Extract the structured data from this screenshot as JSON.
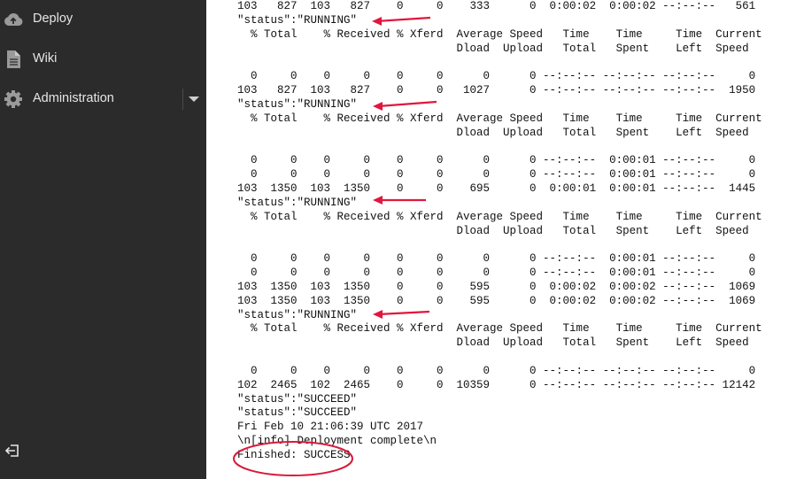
{
  "sidebar": {
    "items": [
      {
        "label": "Deploy",
        "icon": "cloud-upload-icon"
      },
      {
        "label": "Wiki",
        "icon": "document-icon"
      },
      {
        "label": "Administration",
        "icon": "gear-icon"
      }
    ],
    "dropdown_icon": "caret-down-icon",
    "footer_icon": "logout-icon"
  },
  "console": {
    "lines": [
      "103   827  103   827    0     0    333      0  0:00:02  0:00:02 --:--:--   561",
      "\"status\":\"RUNNING\"",
      "  % Total    % Received % Xferd  Average Speed   Time    Time     Time  Current",
      "                                 Dload  Upload   Total   Spent    Left  Speed",
      "",
      "  0     0    0     0    0     0      0      0 --:--:-- --:--:-- --:--:--     0",
      "103   827  103   827    0     0   1027      0 --:--:-- --:--:-- --:--:--  1950",
      "\"status\":\"RUNNING\"",
      "  % Total    % Received % Xferd  Average Speed   Time    Time     Time  Current",
      "                                 Dload  Upload   Total   Spent    Left  Speed",
      "",
      "  0     0    0     0    0     0      0      0 --:--:--  0:00:01 --:--:--     0",
      "  0     0    0     0    0     0      0      0 --:--:--  0:00:01 --:--:--     0",
      "103  1350  103  1350    0     0    695      0  0:00:01  0:00:01 --:--:--  1445",
      "\"status\":\"RUNNING\"",
      "  % Total    % Received % Xferd  Average Speed   Time    Time     Time  Current",
      "                                 Dload  Upload   Total   Spent    Left  Speed",
      "",
      "  0     0    0     0    0     0      0      0 --:--:--  0:00:01 --:--:--     0",
      "  0     0    0     0    0     0      0      0 --:--:--  0:00:01 --:--:--     0",
      "103  1350  103  1350    0     0    595      0  0:00:02  0:00:02 --:--:--  1069",
      "103  1350  103  1350    0     0    595      0  0:00:02  0:00:02 --:--:--  1069",
      "\"status\":\"RUNNING\"",
      "  % Total    % Received % Xferd  Average Speed   Time    Time     Time  Current",
      "                                 Dload  Upload   Total   Spent    Left  Speed",
      "",
      "  0     0    0     0    0     0      0      0 --:--:-- --:--:-- --:--:--     0",
      "102  2465  102  2465    0     0  10359      0 --:--:-- --:--:-- --:--:-- 12142",
      "\"status\":\"SUCCEED\"",
      "\"status\":\"SUCCEED\"",
      "Fri Feb 10 21:06:39 UTC 2017",
      "\\n[info] Deployment complete\\n",
      "Finished: SUCCESS"
    ]
  },
  "annotations": {
    "arrow_color": "#e0173e",
    "ellipse_color": "#d91a3a"
  }
}
